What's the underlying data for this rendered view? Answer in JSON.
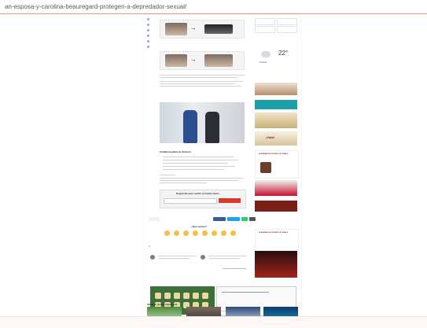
{
  "browser": {
    "url": "an-esposa-y-carolina-beauregard-protegen-a-depredador-sexual/"
  },
  "weather": {
    "temp": "22°",
    "city": "Puebla"
  },
  "subscribe": {
    "title": "Regístrate para recibir el boletín diario",
    "button": ""
  },
  "reactions": {
    "title": "¿Qué opinas?"
  },
  "article": {
    "section_heading": "Cambia la pauta en Amazon"
  },
  "sidebar": {
    "ad1_line": "¡Vota!",
    "ad2_title": "GOBERNAD DEL ESTADO DE PUEBLA",
    "ad3_title": "GOBERNAD DEL ESTADO DE PUEBLA"
  },
  "footer": {
    "more_title": "También podría interesarte"
  },
  "colors": {
    "accent": "#d93a2b",
    "url_underline": "#e79a94"
  },
  "icons": {
    "arrow": "→"
  }
}
